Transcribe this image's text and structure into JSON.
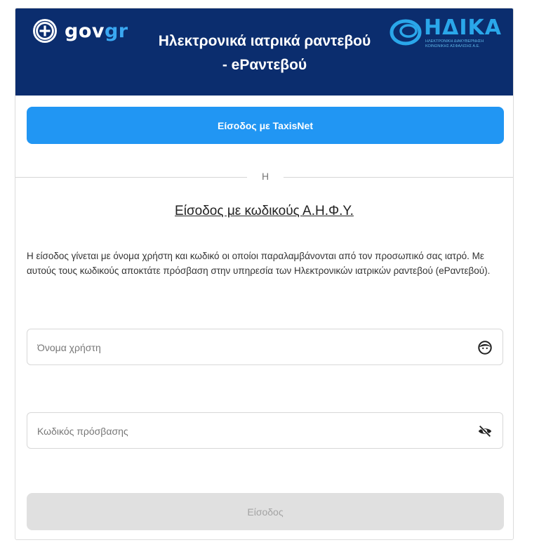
{
  "header": {
    "gov_logo": {
      "part1": "gov",
      "part2": "gr"
    },
    "title_line1": "Ηλεκτρονικά ιατρικά ραντεβού",
    "title_line2": "- eΡαντεβού",
    "idika_logo": {
      "name": "ΗΔΙΚΑ",
      "subtitle": "ΗΛΕΚΤΡΟΝΙΚΗ ΔΙΑΚΥΒΕΡΝΗΣΗ ΚΟΙΝΩΝΙΚΗΣ ΑΣΦΑΛΙΣΗΣ Α.Ε."
    },
    "background_color": "#0b2d6e"
  },
  "taxisnet_button": {
    "label": "Είσοδος με TaxisNet",
    "color": "#2196f3"
  },
  "divider_text": "Η",
  "ahfy_section": {
    "heading": "Είσοδος με κωδικούς Α.Η.Φ.Υ.",
    "description": "Η είσοδος γίνεται με όνομα χρήστη και κωδικό οι οποίοι παραλαμβάνονται από τον προσωπικό σας ιατρό. Με αυτούς τους κωδικούς αποκτάτε πρόσβαση στην υπηρεσία των Ηλεκτρονικών ιατρικών ραντεβού (eΡαντεβού)."
  },
  "form": {
    "username": {
      "placeholder": "Όνομα χρήστη",
      "value": "",
      "icon": "face-icon"
    },
    "password": {
      "placeholder": "Κωδικός πρόσβασης",
      "value": "",
      "icon": "eye-off-icon"
    },
    "submit_label": "Είσοδος"
  }
}
